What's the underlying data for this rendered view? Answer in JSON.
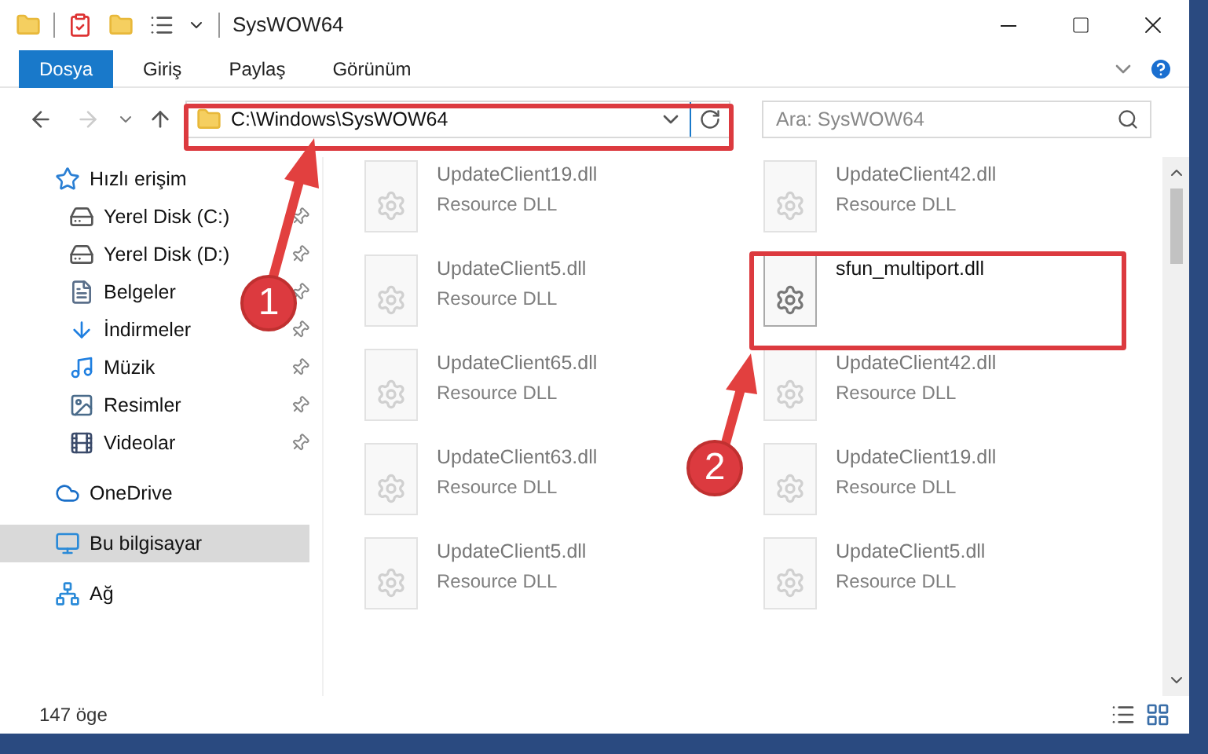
{
  "window": {
    "title": "SysWOW64"
  },
  "ribbon_tabs": [
    {
      "label": "Dosya",
      "selected": true
    },
    {
      "label": "Giriş",
      "selected": false
    },
    {
      "label": "Paylaş",
      "selected": false
    },
    {
      "label": "Görünüm",
      "selected": false
    }
  ],
  "address_bar": {
    "path": "C:\\Windows\\SysWOW64"
  },
  "search": {
    "placeholder": "Ara: SysWOW64"
  },
  "sidebar": {
    "items": [
      {
        "label": "Hızlı erişim",
        "kind": "quick",
        "selected": false,
        "children": [
          {
            "label": "Yerel Disk (C:)",
            "kind": "diskc",
            "pinned": true,
            "selected": false
          },
          {
            "label": "Yerel Disk (D:)",
            "kind": "disk",
            "pinned": true,
            "selected": false
          },
          {
            "label": "Belgeler",
            "kind": "docs",
            "pinned": true,
            "selected": false
          },
          {
            "label": "İndirmeler",
            "kind": "downloads",
            "pinned": true,
            "selected": false
          },
          {
            "label": "Müzik",
            "kind": "music",
            "pinned": true,
            "selected": false
          },
          {
            "label": "Resimler",
            "kind": "pictures",
            "pinned": true,
            "selected": false
          },
          {
            "label": "Videolar",
            "kind": "videos",
            "pinned": true,
            "selected": false
          }
        ]
      },
      {
        "label": "OneDrive",
        "kind": "cloud",
        "selected": false
      },
      {
        "label": "Bu bilgisayar",
        "kind": "pc",
        "selected": true
      },
      {
        "label": "Ağ",
        "kind": "network",
        "selected": false
      }
    ]
  },
  "files": [
    {
      "name": "UpdateClient19.dll",
      "type": "Resource DLL",
      "faded": true
    },
    {
      "name": "UpdateClient42.dll",
      "type": "Resource DLL",
      "faded": true
    },
    {
      "name": "UpdateClient5.dll",
      "type": "Resource DLL",
      "faded": true
    },
    {
      "name": "sfun_multiport.dll",
      "faded": false
    },
    {
      "name": "UpdateClient65.dll",
      "type": "Resource DLL",
      "faded": true
    },
    {
      "name": "UpdateClient42.dll",
      "type": "Resource DLL",
      "faded": true
    },
    {
      "name": "UpdateClient63.dll",
      "type": "Resource DLL",
      "faded": true
    },
    {
      "name": "UpdateClient19.dll",
      "type": "Resource DLL",
      "faded": true
    },
    {
      "name": "UpdateClient5.dll",
      "type": "Resource DLL",
      "faded": true
    },
    {
      "name": "UpdateClient5.dll",
      "type": "Resource DLL",
      "faded": true
    }
  ],
  "status_bar": {
    "count": "147 öge"
  },
  "annotations": [
    {
      "number": "1"
    },
    {
      "number": "2"
    }
  ]
}
